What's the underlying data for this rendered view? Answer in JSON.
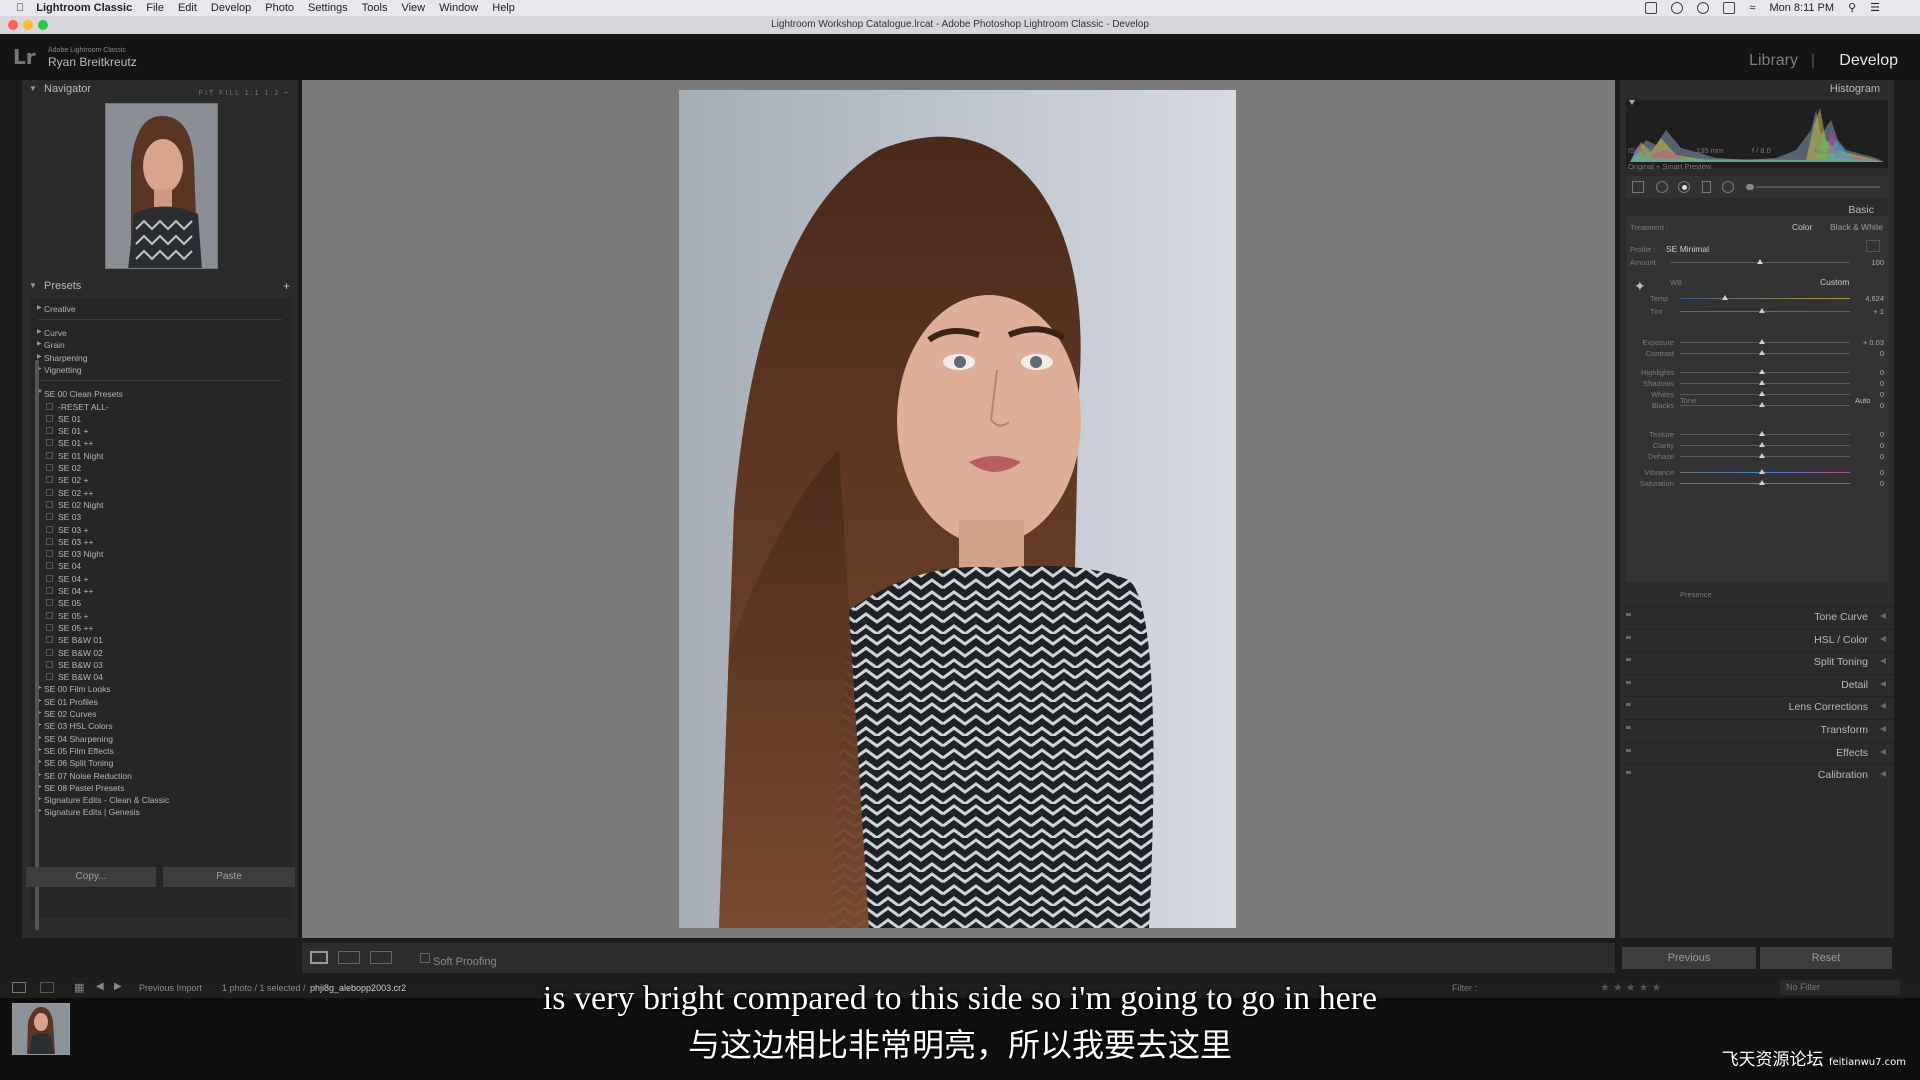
{
  "menubar": {
    "app": "Lightroom Classic",
    "items": [
      "File",
      "Edit",
      "Develop",
      "Photo",
      "Settings",
      "Tools",
      "View",
      "Window",
      "Help"
    ],
    "clock": "Mon 8:11 PM"
  },
  "window": {
    "title": "Lightroom Workshop Catalogue.lrcat - Adobe Photoshop Lightroom Classic - Develop"
  },
  "identity": {
    "logo": "Lr",
    "product": "Adobe Lightroom Classic",
    "user": "Ryan Breitkreutz",
    "modules": [
      "Library",
      "Develop"
    ],
    "separator": "|"
  },
  "navigator": {
    "title": "Navigator",
    "options": "FIT FILL 1:1 1:2 ÷"
  },
  "presets": {
    "title": "Presets",
    "add": "+",
    "groups_top": [
      "Creative",
      "Curve",
      "Grain",
      "Sharpening",
      "Vignetting"
    ],
    "open_group": "SE 00 Clean Presets",
    "open_items": [
      "-RESET ALL-",
      "SE 01",
      "SE 01 +",
      "SE 01 ++",
      "SE 01 Night",
      "SE 02",
      "SE 02 +",
      "SE 02 ++",
      "SE 02 Night",
      "SE 03",
      "SE 03 +",
      "SE 03 ++",
      "SE 03 Night",
      "SE 04",
      "SE 04 +",
      "SE 04 ++",
      "SE 05",
      "SE 05 +",
      "SE 05 ++",
      "SE B&W 01",
      "SE B&W 02",
      "SE B&W 03",
      "SE B&W 04"
    ],
    "groups_bottom": [
      "SE 00 Film Looks",
      "SE 01 Profiles",
      "SE 02 Curves",
      "SE 03 HSL Colors",
      "SE 04 Sharpening",
      "SE 05 Film Effects",
      "SE 06 Split Toning",
      "SE 07 Noise Reduction",
      "SE 08 Pastel Presets",
      "Signature Edits - Clean & Classic",
      "Signature Edits | Genesis"
    ]
  },
  "left_buttons": {
    "copy": "Copy...",
    "paste": "Paste"
  },
  "toolbar": {
    "soft_proofing": "Soft Proofing"
  },
  "histogram": {
    "title": "Histogram",
    "iso": "ISO 64",
    "focal": "135 mm",
    "aperture": "f / 8.0",
    "shutter": "⅛₀ sec",
    "preview": "Original + Smart Preview"
  },
  "basic": {
    "title": "Basic",
    "treatment_label": "Treatment :",
    "color": "Color",
    "bw": "Black & White",
    "profile_label": "Profile :",
    "profile_value": "SE Minimal",
    "amount_label": "Amount",
    "amount_value": "100",
    "wb_label": "WB :",
    "wb_value": "Custom",
    "temp_label": "Temp",
    "temp_value": "4,624",
    "tint_label": "Tint",
    "tint_value": "+ 1",
    "tone_label": "Tone",
    "auto": "Auto",
    "exposure_label": "Exposure",
    "exposure_value": "+ 0.03",
    "contrast_label": "Contrast",
    "contrast_value": "0",
    "highlights_label": "Highlights",
    "highlights_value": "0",
    "shadows_label": "Shadows",
    "shadows_value": "0",
    "whites_label": "Whites",
    "whites_value": "0",
    "blacks_label": "Blacks",
    "blacks_value": "0",
    "presence_label": "Presence",
    "texture_label": "Texture",
    "texture_value": "0",
    "clarity_label": "Clarity",
    "clarity_value": "0",
    "dehaze_label": "Dehaze",
    "dehaze_value": "0",
    "vibrance_label": "Vibrance",
    "vibrance_value": "0",
    "saturation_label": "Saturation",
    "saturation_value": "0"
  },
  "panels": [
    "Tone Curve",
    "HSL / Color",
    "Split Toning",
    "Detail",
    "Lens Corrections",
    "Transform",
    "Effects",
    "Calibration"
  ],
  "right_buttons": {
    "previous": "Previous",
    "reset": "Reset"
  },
  "filmbar": {
    "source": "Previous Import",
    "count": "1 photo / 1 selected /",
    "filename": "phji8g_alebopp2003.cr2",
    "filter_label": "Filter :",
    "filter_value": "No Filter"
  },
  "subtitles": {
    "en": "is very bright compared to this side so i'm going to go in here",
    "zh": "与这边相比非常明亮，所以我要去这里"
  },
  "watermark": {
    "text": "飞天资源论坛",
    "site": "feitianwu7.com"
  }
}
